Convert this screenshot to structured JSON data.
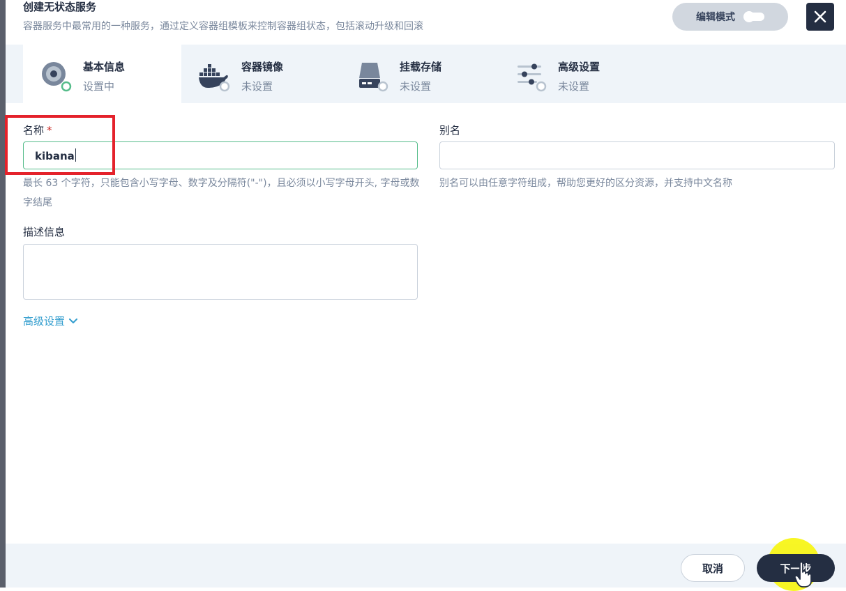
{
  "header": {
    "title": "创建无状态服务",
    "subtitle": "容器服务中最常用的一种服务，通过定义容器组模板来控制容器组状态，包括滚动升级和回滚",
    "edit_mode_label": "编辑模式",
    "close_icon": "close-icon"
  },
  "steps": [
    {
      "name": "基本信息",
      "state": "设置中",
      "icon": "disc-icon",
      "active": true
    },
    {
      "name": "容器镜像",
      "state": "未设置",
      "icon": "docker-icon",
      "active": false
    },
    {
      "name": "挂载存储",
      "state": "未设置",
      "icon": "storage-icon",
      "active": false
    },
    {
      "name": "高级设置",
      "state": "未设置",
      "icon": "settings-sliders-icon",
      "active": false
    }
  ],
  "form": {
    "name_label": "名称",
    "required_mark": "*",
    "name_value": "kibana",
    "name_hint": "最长 63 个字符，只能包含小写字母、数字及分隔符(\"-\")，且必须以小写字母开头, 字母或数字结尾",
    "alias_label": "别名",
    "alias_value": "",
    "alias_hint": "别名可以由任意字符组成，帮助您更好的区分资源，并支持中文名称",
    "description_label": "描述信息",
    "description_value": "",
    "advanced_link": "高级设置"
  },
  "footer": {
    "cancel_label": "取消",
    "next_label": "下一步"
  },
  "colors": {
    "primary_dark": "#242e42",
    "success_green": "#55bc8a",
    "link_blue": "#329dce",
    "annotation_red": "#e4222b",
    "cursor_yellow": "#f7f50c"
  }
}
